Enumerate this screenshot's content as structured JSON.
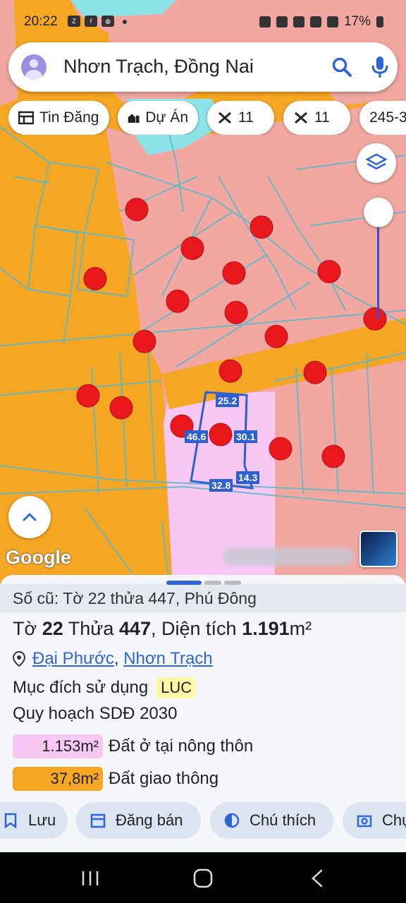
{
  "status_bar": {
    "time": "20:22",
    "battery": "17%",
    "left_icons": [
      "zalo-icon",
      "facebook-icon",
      "globe-icon",
      "dot-icon"
    ],
    "right_icons": [
      "alarm-icon",
      "mute-icon",
      "location-icon",
      "wifi-icon",
      "volte-icon",
      "signal-icon",
      "battery-icon"
    ]
  },
  "search": {
    "query": "Nhơn Trạch, Đồng Nai"
  },
  "chips": [
    {
      "label": "Tin Đăng",
      "icon": "listing-icon"
    },
    {
      "label": "Dự Án",
      "icon": "buildings-icon"
    },
    {
      "label": "11",
      "icon": "tools-icon"
    },
    {
      "label": "11",
      "icon": "tools-icon"
    },
    {
      "label": "245-3",
      "icon": ""
    }
  ],
  "map": {
    "google_label": "Google",
    "dimensions": [
      "25.2",
      "46.6",
      "30.1",
      "14.3",
      "32.8"
    ],
    "colors": {
      "orange": "#f5a623",
      "pink": "#f2a7a0",
      "light_pink": "#f8c8f4",
      "cyan": "#8be3e8",
      "marker": "#e8181c",
      "parcel_line": "#2d5fd0"
    }
  },
  "sheet": {
    "old_ref": "Số cũ: Tờ 22 thửa 447, Phú Đông",
    "parcel": {
      "to_label": "Tờ",
      "to_value": "22",
      "thua_label": "Thửa",
      "thua_value": "447",
      "area_label": "Diện tích",
      "area_value": "1.191",
      "area_unit": "m²"
    },
    "location": {
      "ward": "Đại Phước",
      "district": "Nhơn Trạch",
      "separator": ", "
    },
    "purpose": {
      "label": "Mục đích sử dụng",
      "code": "LUC"
    },
    "plan_title": "Quy hoạch SDĐ 2030",
    "land_use": [
      {
        "area": "1.153m²",
        "label": "Đất ở tại nông thôn",
        "color": "#f8c8f4"
      },
      {
        "area": "37,8m²",
        "label": "Đất giao thông",
        "color": "#f5a623"
      }
    ]
  },
  "actions": [
    {
      "label": "Lưu",
      "icon": "bookmark-icon"
    },
    {
      "label": "Đăng bán",
      "icon": "calendar-icon"
    },
    {
      "label": "Chú thích",
      "icon": "contrast-icon"
    },
    {
      "label": "Chụ",
      "icon": "camera-icon"
    }
  ]
}
